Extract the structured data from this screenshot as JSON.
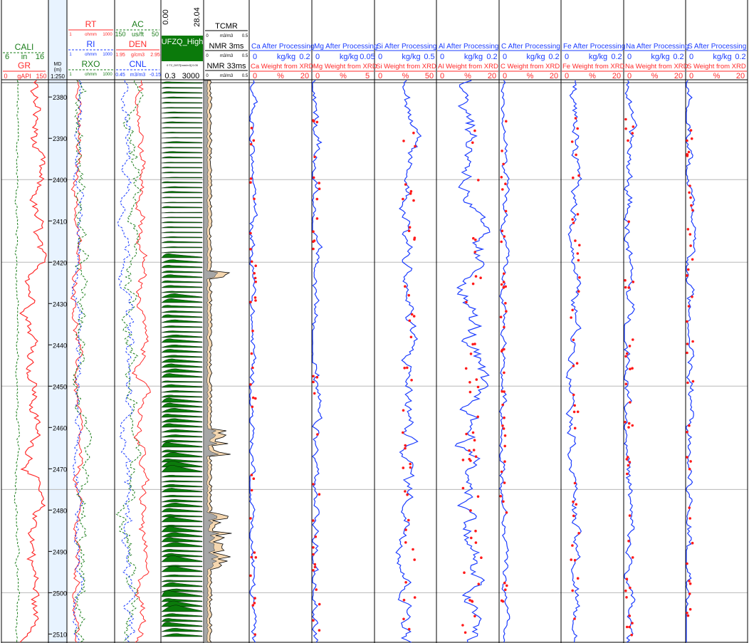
{
  "colors": {
    "red": "#ff2a2a",
    "blue": "#1b3cff",
    "green": "#1a7d1a",
    "dark_green": "#0f7a0f",
    "grid": "#b8b8b8",
    "track_border": "#000000",
    "md_track": "#e8f3ff",
    "nmr_fill": "#f5d7b0",
    "nmr_gray": "#a6a6a6",
    "t2_fill": "#0b7a0b",
    "xrd_point": "#ff1a1a"
  },
  "chart_data": {
    "type": "well_log",
    "depth_unit": "m",
    "md_header": [
      "MD",
      "(m)",
      "1:250"
    ],
    "depth_range": [
      2376,
      2512
    ],
    "depth_ticks": [
      2380,
      2390,
      2400,
      2410,
      2420,
      2430,
      2440,
      2450,
      2460,
      2470,
      2480,
      2490,
      2500,
      2510
    ],
    "major_gridlines": [
      2400,
      2420,
      2450,
      2475,
      2500
    ],
    "tracks": [
      {
        "id": "caligr",
        "curves": [
          {
            "name": "CALI",
            "color": "green",
            "dash": true,
            "min": "6",
            "unit": "in",
            "max": "16"
          },
          {
            "name": "GR",
            "color": "red",
            "dash": false,
            "min": "0",
            "unit": "gAPI",
            "max": "150"
          }
        ]
      },
      {
        "id": "resist",
        "curves": [
          {
            "name": "RT",
            "color": "red",
            "dash": false,
            "min": "1",
            "unit": "ohmm",
            "max": "1000"
          },
          {
            "name": "RI",
            "color": "blue",
            "dash": true,
            "min": "1",
            "unit": "ohmm",
            "max": "1000"
          },
          {
            "name": "RXO",
            "color": "green",
            "dash": true,
            "min": "1",
            "unit": "ohmm",
            "max": "1000"
          }
        ]
      },
      {
        "id": "porosity",
        "curves": [
          {
            "name": "AC",
            "color": "green",
            "dash": true,
            "min": "150",
            "unit": "us/ft",
            "max": "50"
          },
          {
            "name": "DEN",
            "color": "red",
            "dash": false,
            "min": "1.95",
            "unit": "g/cm3",
            "max": "2.95"
          },
          {
            "name": "CNL",
            "color": "blue",
            "dash": true,
            "min": "0.45",
            "unit": "m3/m3",
            "max": "-0.15"
          }
        ]
      },
      {
        "id": "t2",
        "rotated": [
          "0.00",
          "28.04"
        ],
        "title": "UFZQ_High",
        "small_scale": "0   T2_DIST[mm/m3]   0.05",
        "scale": [
          "0.3",
          "3000"
        ]
      },
      {
        "id": "nmr",
        "curves": [
          {
            "name": "TCMR",
            "min": "0",
            "unit": "m3/m3",
            "max": "0.5"
          },
          {
            "name": "NMR_3ms",
            "min": "0",
            "unit": "m3/m3",
            "max": "0.5"
          },
          {
            "name": "NMR_33ms",
            "min": "0",
            "unit": "m3/m3",
            "max": "0.5"
          }
        ]
      }
    ],
    "element_tracks": [
      {
        "element": "Ca",
        "title": "Ca  After Processing",
        "unit": "kg/kg",
        "max": "0.2",
        "xrd_title": "Ca Weight from XRD",
        "xrd_max": "20"
      },
      {
        "element": "Mg",
        "title": "Mg After Processing",
        "unit": "kg/kg",
        "max": "0.05",
        "xrd_title": "Mg Weight from XRD",
        "xrd_max": "5"
      },
      {
        "element": "Si",
        "title": "Si  After Processing",
        "unit": "kg/kg",
        "max": "0.5",
        "xrd_title": "Si Weight from XRD",
        "xrd_max": "50"
      },
      {
        "element": "Al",
        "title": "Al  After Processing",
        "unit": "kg/kg",
        "max": "0.2",
        "xrd_title": "Al Weight from XRD",
        "xrd_max": "20"
      },
      {
        "element": "C",
        "title": "C  After Processing",
        "unit": "kg/kg",
        "max": "0.2",
        "xrd_title": "C Weight from XRD",
        "xrd_max": "20"
      },
      {
        "element": "Fe",
        "title": "Fe After Processing",
        "unit": "kg/kg",
        "max": "0.2",
        "xrd_title": "Fe Weight from XRD",
        "xrd_max": "20"
      },
      {
        "element": "Na",
        "title": "Na  After Processing",
        "unit": "kg/kg",
        "max": "0.2",
        "xrd_title": "Na Weight from XRD",
        "xrd_max": "20"
      },
      {
        "element": "S",
        "title": "S  After Processing",
        "unit": "kg/kg",
        "max": "0.2",
        "xrd_title": "S Weight from XRD",
        "xrd_max": "20"
      }
    ],
    "element_scale_min": "0",
    "xrd_scale": [
      "0",
      "%"
    ]
  }
}
